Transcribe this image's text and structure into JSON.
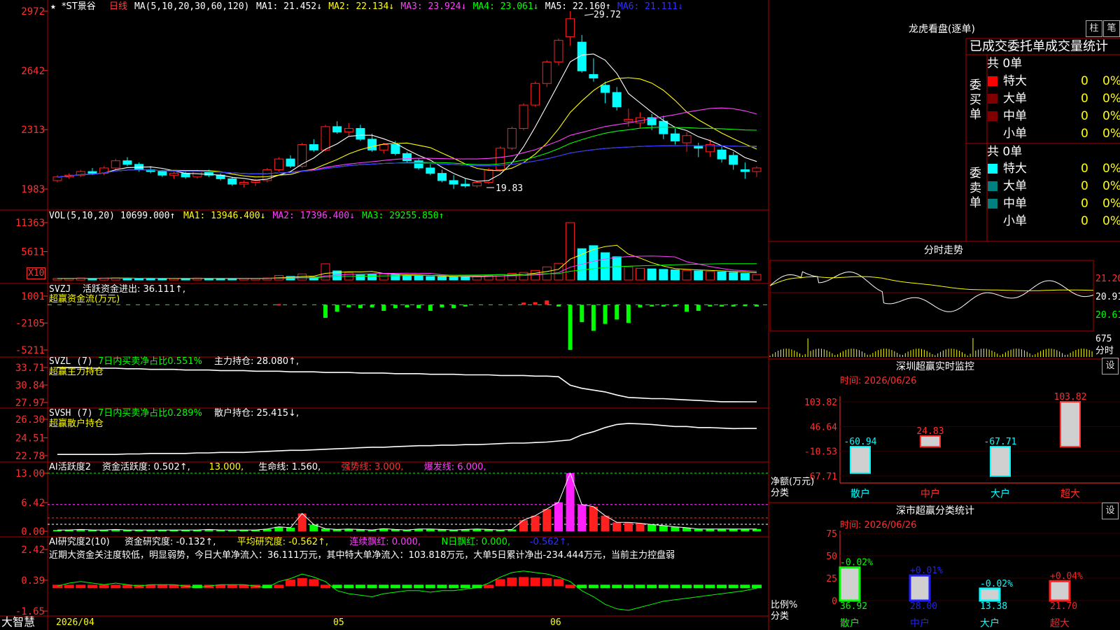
{
  "colors": {
    "up": "#ff2020",
    "down": "#00ffff",
    "grid": "#b00000",
    "axis": "#ff3030",
    "ma1": "#ffffff",
    "ma2": "#ffff00",
    "ma3": "#ff40ff",
    "ma4": "#00ff00",
    "ma5": "#aaaaaa",
    "ma6": "#3030ff"
  },
  "header": {
    "title": "*ST景谷",
    "period": "日线",
    "ma_label": "MA(5,10,20,30,60,120)",
    "ma": [
      {
        "label": "MA1:",
        "value": "21.452↓",
        "color": "#ffffff"
      },
      {
        "label": "MA2:",
        "value": "22.134↓",
        "color": "#ffff00"
      },
      {
        "label": "MA3:",
        "value": "23.924↓",
        "color": "#ff40ff"
      },
      {
        "label": "MA4:",
        "value": "23.061↓",
        "color": "#00ff00"
      },
      {
        "label": "MA5:",
        "value": "22.160↑",
        "color": "#ffffff"
      },
      {
        "label": "MA6:",
        "value": "21.111↓",
        "color": "#3030ff"
      }
    ],
    "high_marker": "29.72",
    "low_marker": "19.83"
  },
  "axes": {
    "price": [
      "2972",
      "2642",
      "2313",
      "1983"
    ],
    "vol": [
      "11363",
      "5611"
    ],
    "vol_unit": "X10",
    "svzj": [
      "1001",
      "-2105",
      "-5211"
    ],
    "svzl": [
      "33.71",
      "30.84",
      "27.97"
    ],
    "svsh": [
      "26.30",
      "24.51",
      "22.78"
    ],
    "ai": [
      "13.00",
      "6.42",
      "0.00"
    ],
    "ai2": [
      "2.42",
      "0.39",
      "-1.65"
    ]
  },
  "panels": {
    "vol": {
      "name": "VOL(5,10,20)",
      "v": "10699.000↑",
      "items": [
        {
          "label": "MA1:",
          "value": "13946.400↓",
          "color": "#ffff00"
        },
        {
          "label": "MA2:",
          "value": "17396.400↓",
          "color": "#ff40ff"
        },
        {
          "label": "MA3:",
          "value": "29255.850↑",
          "color": "#00ff00"
        }
      ]
    },
    "svzj": {
      "name": "SVZJ",
      "line1": "活跃资金进出: 36.111↑,",
      "line2": "超赢资金流(万元)"
    },
    "svzl": {
      "name": "SVZL (7)",
      "pct": "7日内买卖净占比0.551%",
      "hold": "主力持仓: 28.080↑,",
      "line2": "超赢主力持仓"
    },
    "svsh": {
      "name": "SVSH (7)",
      "pct": "7日内买卖净占比0.289%",
      "hold": "散户持仓: 25.415↓,",
      "line2": "超赢散户持仓"
    },
    "ai": {
      "name": "AI活跃度2",
      "items": [
        {
          "t": "资金活跃度: 0.502↑,",
          "c": "#ffffff"
        },
        {
          "t": "13.000,",
          "c": "#ffff00"
        },
        {
          "t": "生命线: 1.560,",
          "c": "#ffffff"
        },
        {
          "t": "强势线: 3.000,",
          "c": "#ff3030"
        },
        {
          "t": "爆发线: 6.000,",
          "c": "#ff40ff"
        }
      ]
    },
    "ai2": {
      "name": "AI研究度2(10)",
      "items": [
        {
          "t": "资金研究度: -0.132↑,",
          "c": "#ffffff"
        },
        {
          "t": "平均研究度: -0.562↑,",
          "c": "#ffff00"
        },
        {
          "t": "连续飘红: 0.000,",
          "c": "#ff40ff"
        },
        {
          "t": "N日飘红: 0.000,",
          "c": "#00ff00"
        },
        {
          "t": "-0.562↑,",
          "c": "#3030ff"
        }
      ],
      "comment": "近期大资金关注度较低，明显弱势，今日大单净流入：36.111万元，其中特大单净流入：103.818万元，大单5日累计净出-234.444万元，当前主力控盘弱"
    }
  },
  "xaxis": {
    "date": "2026/04",
    "m5": "05",
    "m6": "06"
  },
  "footer_brand": "大智慧",
  "right": {
    "lhb": {
      "title": "龙虎看盘(逐单)",
      "btn1": "柱",
      "btn2": "笔",
      "subtitle": "已成交委托单成交量统计",
      "buy": {
        "vlabel": "委买单",
        "total": "共 0单",
        "rows": [
          {
            "name": "特大",
            "color": "#ff0000",
            "n": "0",
            "pct": "0%"
          },
          {
            "name": "大单",
            "color": "#800000",
            "n": "0",
            "pct": "0%"
          },
          {
            "name": "中单",
            "color": "#800000",
            "n": "0",
            "pct": "0%"
          },
          {
            "name": "小单",
            "color": "",
            "n": "0",
            "pct": "0%"
          }
        ]
      },
      "sell": {
        "vlabel": "委卖单",
        "total": "共 0单",
        "rows": [
          {
            "name": "特大",
            "color": "#00ffff",
            "n": "0",
            "pct": "0%"
          },
          {
            "name": "大单",
            "color": "#008080",
            "n": "0",
            "pct": "0%"
          },
          {
            "name": "中单",
            "color": "#008080",
            "n": "0",
            "pct": "0%"
          },
          {
            "name": "小单",
            "color": "",
            "n": "0",
            "pct": "0%"
          }
        ]
      }
    },
    "fs": {
      "title": "分时走势",
      "y": [
        "21.20",
        "20.91",
        "20.61"
      ],
      "vol": "675",
      "unit": "分时"
    },
    "monitor": {
      "title": "深圳超赢实时监控",
      "btn": "设",
      "time": "时间: 2026/06/26",
      "axis": [
        "103.82",
        "46.64",
        "-10.53",
        "-67.71"
      ],
      "ylabel": "净额(万元)",
      "xlabel": "分类"
    },
    "stats": {
      "title": "深市超赢分类统计",
      "btn": "设",
      "time": "时间: 2026/06/26",
      "axis": [
        "75",
        "50",
        "25",
        "0"
      ],
      "ylabel": "比例%",
      "xlabel": "分类"
    }
  },
  "chart_data": [
    {
      "type": "candlestick",
      "title": "*ST景谷 日线",
      "y_ticks": [
        19.83,
        23.13,
        26.42,
        29.72
      ],
      "high": 29.72,
      "low": 19.83,
      "ohlc": [
        [
          20.3,
          20.6,
          20.2,
          20.5
        ],
        [
          20.5,
          20.7,
          20.4,
          20.6
        ],
        [
          20.6,
          20.9,
          20.5,
          20.8
        ],
        [
          20.8,
          21.0,
          20.6,
          20.7
        ],
        [
          20.7,
          21.1,
          20.6,
          21.0
        ],
        [
          21.0,
          21.5,
          20.9,
          21.4
        ],
        [
          21.4,
          21.6,
          21.1,
          21.2
        ],
        [
          21.2,
          21.3,
          20.8,
          20.9
        ],
        [
          20.9,
          21.1,
          20.7,
          20.8
        ],
        [
          20.8,
          20.9,
          20.5,
          20.6
        ],
        [
          20.6,
          20.8,
          20.4,
          20.7
        ],
        [
          20.7,
          20.8,
          20.4,
          20.5
        ],
        [
          20.5,
          20.9,
          20.4,
          20.8
        ],
        [
          20.8,
          20.9,
          20.5,
          20.6
        ],
        [
          20.6,
          20.7,
          20.3,
          20.4
        ],
        [
          20.4,
          20.5,
          20.0,
          20.1
        ],
        [
          20.1,
          20.3,
          19.9,
          20.2
        ],
        [
          20.2,
          20.4,
          20.0,
          20.3
        ],
        [
          20.3,
          21.0,
          20.2,
          20.9
        ],
        [
          20.9,
          21.6,
          20.8,
          21.5
        ],
        [
          21.5,
          21.7,
          21.0,
          21.1
        ],
        [
          21.1,
          22.4,
          21.0,
          22.3
        ],
        [
          22.3,
          22.6,
          21.9,
          22.0
        ],
        [
          22.0,
          23.4,
          21.9,
          23.3
        ],
        [
          23.3,
          23.6,
          22.9,
          23.0
        ],
        [
          23.0,
          23.5,
          22.8,
          23.2
        ],
        [
          23.2,
          23.4,
          22.5,
          22.6
        ],
        [
          22.6,
          22.9,
          21.9,
          22.0
        ],
        [
          22.0,
          22.4,
          21.8,
          22.3
        ],
        [
          22.3,
          22.5,
          21.7,
          21.8
        ],
        [
          21.8,
          21.9,
          21.3,
          21.4
        ],
        [
          21.4,
          21.5,
          20.9,
          21.0
        ],
        [
          21.0,
          21.2,
          20.6,
          20.7
        ],
        [
          20.7,
          20.9,
          20.2,
          20.3
        ],
        [
          20.3,
          20.6,
          19.83,
          20.1
        ],
        [
          20.1,
          20.4,
          19.9,
          20.0
        ],
        [
          20.0,
          20.3,
          19.9,
          20.2
        ],
        [
          20.2,
          21.0,
          20.1,
          20.9
        ],
        [
          20.9,
          22.2,
          20.8,
          22.1
        ],
        [
          22.1,
          23.3,
          22.0,
          23.2
        ],
        [
          23.2,
          24.6,
          23.1,
          24.5
        ],
        [
          24.5,
          25.8,
          24.4,
          25.7
        ],
        [
          25.7,
          27.0,
          25.5,
          26.9
        ],
        [
          26.9,
          28.2,
          26.7,
          28.1
        ],
        [
          28.3,
          29.72,
          27.8,
          29.3
        ],
        [
          28.0,
          28.4,
          26.3,
          26.4
        ],
        [
          26.2,
          27.1,
          25.8,
          26.0
        ],
        [
          25.6,
          25.8,
          24.6,
          25.2
        ],
        [
          25.2,
          25.5,
          24.2,
          24.4
        ],
        [
          23.6,
          24.3,
          23.3,
          23.7
        ],
        [
          23.5,
          24.1,
          23.2,
          23.8
        ],
        [
          23.8,
          24.0,
          23.1,
          23.4
        ],
        [
          23.6,
          23.9,
          22.6,
          22.9
        ],
        [
          22.9,
          23.2,
          22.3,
          22.5
        ],
        [
          22.4,
          23.0,
          21.9,
          22.8
        ],
        [
          22.2,
          22.4,
          21.6,
          22.1
        ],
        [
          21.9,
          22.6,
          21.6,
          22.3
        ],
        [
          22.0,
          22.2,
          21.3,
          21.5
        ],
        [
          21.7,
          21.9,
          20.9,
          21.2
        ],
        [
          20.9,
          21.3,
          20.4,
          20.8
        ],
        [
          20.8,
          21.1,
          20.5,
          21.0
        ]
      ]
    },
    {
      "type": "bar",
      "title": "VOL(5,10,20)",
      "unit": "X10",
      "y_ticks": [
        5611,
        11363
      ],
      "values": [
        300,
        350,
        400,
        300,
        380,
        420,
        360,
        300,
        310,
        300,
        320,
        300,
        380,
        300,
        280,
        300,
        300,
        300,
        400,
        900,
        700,
        1200,
        600,
        3200,
        1800,
        1400,
        1000,
        1100,
        1200,
        1000,
        900,
        800,
        700,
        650,
        600,
        650,
        700,
        900,
        1100,
        1300,
        1500,
        1900,
        2600,
        3300,
        11363,
        6200,
        6800,
        5400,
        4600,
        2600,
        2300,
        2200,
        2100,
        2000,
        1900,
        1800,
        1700,
        1600,
        1500,
        1300,
        1100
      ]
    },
    {
      "type": "bar",
      "title": "SVZJ",
      "y_ticks": [
        -5211,
        -2105,
        1001
      ],
      "values": [
        0,
        0,
        0,
        0,
        0,
        0,
        0,
        0,
        0,
        0,
        0,
        0,
        0,
        0,
        0,
        0,
        0,
        0,
        0,
        80,
        0,
        0,
        0,
        -1500,
        -800,
        -300,
        -400,
        -300,
        -700,
        -400,
        -300,
        -400,
        -700,
        -300,
        -400,
        -200,
        0,
        0,
        0,
        0,
        250,
        300,
        500,
        -200,
        -5200,
        -2000,
        -3000,
        -2200,
        -1700,
        -2100,
        -300,
        -200,
        -200,
        -200,
        -800,
        -700,
        -200,
        -200,
        -200,
        -100,
        -200
      ]
    },
    {
      "type": "line",
      "title": "SVZL (7)",
      "y_ticks": [
        27.97,
        30.84,
        33.71
      ],
      "values": [
        33.7,
        33.7,
        33.7,
        33.6,
        33.6,
        33.6,
        33.5,
        33.5,
        33.4,
        33.4,
        33.4,
        33.3,
        33.3,
        33.3,
        33.2,
        33.2,
        33.2,
        33.1,
        33.1,
        33.1,
        33.0,
        33.0,
        33.0,
        32.9,
        32.9,
        32.9,
        32.8,
        32.8,
        32.8,
        32.7,
        32.7,
        32.7,
        32.6,
        32.6,
        32.6,
        32.5,
        32.5,
        32.5,
        32.4,
        32.4,
        32.4,
        32.3,
        32.3,
        32.2,
        30.8,
        30.3,
        30.0,
        29.7,
        29.2,
        28.8,
        28.7,
        28.6,
        28.6,
        28.5,
        28.4,
        28.3,
        28.2,
        28.1,
        28.1,
        28.08,
        28.08
      ]
    },
    {
      "type": "line",
      "title": "SVSH (7)",
      "y_ticks": [
        22.78,
        24.51,
        26.3
      ],
      "values": [
        22.9,
        22.9,
        22.9,
        22.9,
        22.9,
        22.9,
        22.95,
        22.95,
        23.0,
        23.0,
        23.0,
        23.0,
        23.05,
        23.05,
        23.1,
        23.1,
        23.1,
        23.15,
        23.2,
        23.25,
        23.3,
        23.3,
        23.35,
        23.4,
        23.45,
        23.5,
        23.55,
        23.6,
        23.6,
        23.65,
        23.7,
        23.75,
        23.75,
        23.8,
        23.8,
        23.85,
        23.85,
        23.9,
        23.95,
        24.0,
        24.0,
        24.05,
        24.1,
        24.2,
        24.3,
        24.8,
        25.1,
        25.5,
        25.8,
        25.9,
        25.85,
        25.8,
        25.7,
        25.6,
        25.6,
        25.5,
        25.5,
        25.45,
        25.4,
        25.42,
        25.415
      ]
    },
    {
      "type": "bar",
      "title": "AI活跃度2",
      "y_ticks": [
        0,
        6.42,
        13.0
      ],
      "values": [
        0.3,
        0.3,
        0.4,
        0.3,
        0.3,
        0.4,
        0.3,
        0.3,
        0.3,
        0.3,
        0.3,
        0.3,
        0.3,
        0.4,
        0.3,
        0.3,
        0.3,
        0.3,
        0.5,
        1.0,
        0.8,
        4.0,
        1.5,
        0.6,
        0.4,
        0.5,
        0.4,
        0.3,
        0.6,
        0.4,
        0.3,
        0.5,
        0.5,
        0.4,
        0.3,
        0.4,
        0.5,
        0.4,
        0.3,
        0.4,
        2.5,
        3.5,
        5.0,
        6.5,
        13.0,
        6.0,
        5.5,
        3.5,
        2.0,
        2.0,
        1.8,
        1.5,
        1.3,
        1.0,
        0.8,
        0.5,
        0.5,
        0.5,
        0.5,
        0.5,
        0.502
      ]
    },
    {
      "type": "bar",
      "title": "AI研究度2(10)",
      "y_ticks": [
        -1.65,
        0.39,
        2.42
      ],
      "values": [
        0,
        0.2,
        0.3,
        0.2,
        0.1,
        0.2,
        0.1,
        0,
        0.1,
        0.1,
        0.1,
        0,
        -0.1,
        0,
        0.1,
        0.1,
        0.1,
        0,
        -0.1,
        0.3,
        0.5,
        0.8,
        0.6,
        0.3,
        -0.3,
        -0.5,
        -0.6,
        -0.7,
        -0.5,
        -0.4,
        -0.3,
        -0.3,
        -0.4,
        -0.3,
        -0.3,
        -0.2,
        -0.1,
        0.2,
        0.6,
        0.9,
        1.0,
        0.9,
        0.8,
        0.6,
        0.3,
        -0.3,
        -0.7,
        -1.2,
        -1.5,
        -1.6,
        -1.4,
        -1.2,
        -1.0,
        -0.9,
        -0.8,
        -0.7,
        -0.6,
        -0.5,
        -0.4,
        -0.3,
        -0.132
      ]
    },
    {
      "type": "bar",
      "title": "深圳超赢实时监控",
      "ylabel": "净额(万元)",
      "categories": [
        "散户",
        "中户",
        "大户",
        "超大"
      ],
      "values": [
        -60.94,
        24.83,
        -67.71,
        103.82
      ],
      "y_ticks": [
        -67.71,
        -10.53,
        46.64,
        103.82
      ]
    },
    {
      "type": "bar",
      "title": "深市超赢分类统计",
      "ylabel": "比例%",
      "categories": [
        "散户",
        "中户",
        "大户",
        "超大"
      ],
      "values": [
        36.92,
        28.0,
        13.38,
        21.7
      ],
      "changes": [
        "-0.02%",
        "+0.01%",
        "-0.02%",
        "+0.04%"
      ],
      "y_ticks": [
        0,
        25,
        50,
        75
      ]
    }
  ]
}
